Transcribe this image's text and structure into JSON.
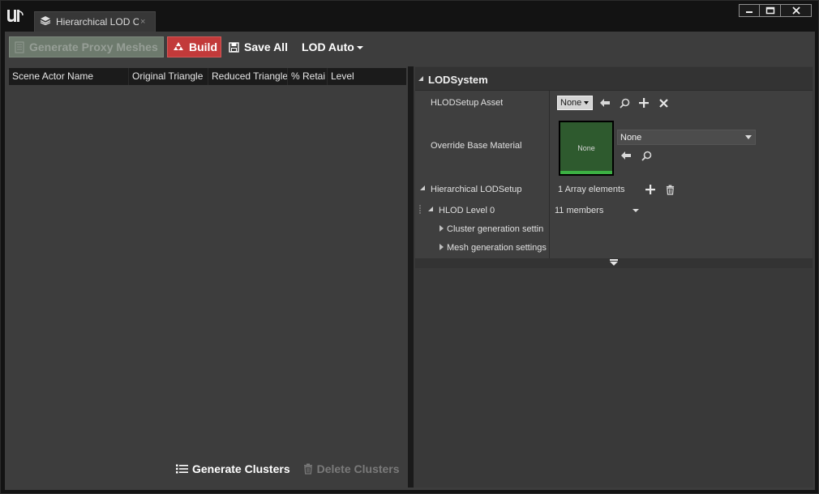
{
  "window": {
    "tab_title": "Hierarchical LOD O",
    "tab_close_glyph": "×",
    "controls": {
      "minimize": "minimize-icon",
      "maximize": "maximize-icon",
      "close": "close-icon"
    }
  },
  "toolbar": {
    "generate_proxy_label": "Generate Proxy Meshes",
    "build_label": "Build",
    "save_all_label": "Save All",
    "lod_auto_label": "LOD Auto"
  },
  "cluster_list": {
    "columns": [
      "Scene Actor Name",
      "Original Triangle",
      "Reduced Triangle",
      "% Retai",
      "Level"
    ],
    "rows": []
  },
  "bottom_actions": {
    "generate_clusters_label": "Generate Clusters",
    "delete_clusters_label": "Delete Clusters"
  },
  "details": {
    "category_title": "LODSystem",
    "hlod_setup_asset": {
      "label": "HLODSetup Asset",
      "value": "None"
    },
    "override_base_material": {
      "label": "Override Base Material",
      "thumbnail_text": "None",
      "value": "None"
    },
    "hierarchical_lod_setup": {
      "label": "Hierarchical LODSetup",
      "value": "1 Array elements"
    },
    "hlod_level": {
      "label": "HLOD Level 0",
      "value": "11 members"
    },
    "cluster_generation_settings_label": "Cluster generation settin",
    "mesh_generation_settings_label": "Mesh generation settings"
  },
  "colors": {
    "build_button": "#c23a3a",
    "proxy_button_disabled": "#6d7a6d",
    "thumbnail_green": "#2e5a2e",
    "thumbnail_bar": "#3cb043"
  }
}
